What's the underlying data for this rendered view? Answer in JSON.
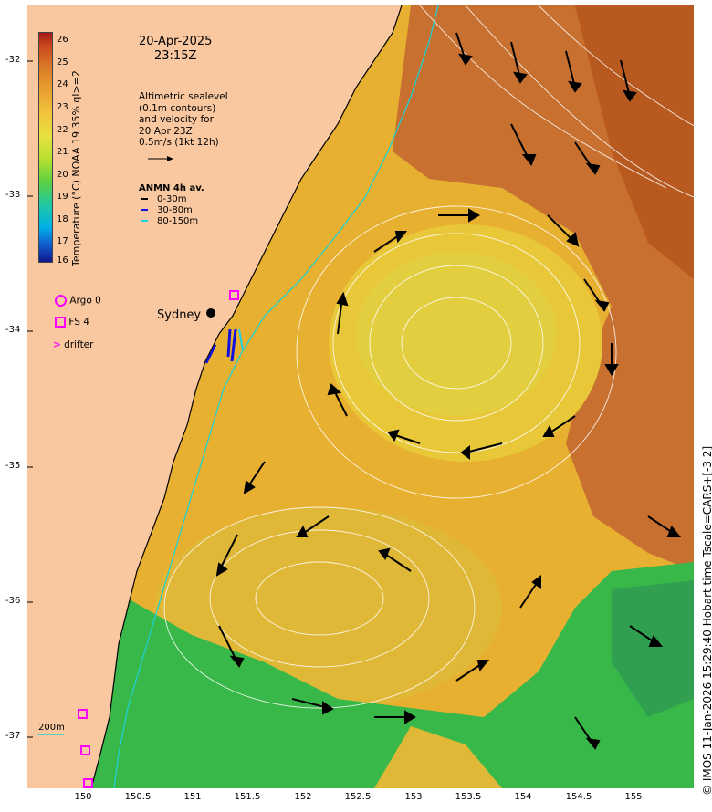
{
  "title": {
    "date": "20-Apr-2025",
    "time": "23:15Z"
  },
  "info": {
    "line1": "Altimetric sealevel",
    "line2": "(0.1m contours)",
    "line3": "and velocity for",
    "line4": "20 Apr 23Z",
    "line5": "0.5m/s (1kt 12h)"
  },
  "anmn": {
    "title": "ANMN 4h av.",
    "rows": [
      {
        "label": "0-30m",
        "color": "#000000"
      },
      {
        "label": "30-80m",
        "color": "#1010e0"
      },
      {
        "label": "80-150m",
        "color": "#20d0e0"
      }
    ]
  },
  "colorbar": {
    "label": "Temperature (°C) NOAA 19 35% ql>=2",
    "ticks": [
      "26",
      "25",
      "24",
      "23",
      "22",
      "21",
      "20",
      "19",
      "18",
      "17",
      "16"
    ]
  },
  "legend": {
    "argo": "Argo 0",
    "fs": "FS 4",
    "drifter": "drifter",
    "marker_color": "#ff00ff"
  },
  "place_label": "Sydney",
  "isobath_label": "200m",
  "lat_ticks": [
    "-32",
    "-33",
    "-34",
    "-35",
    "-36",
    "-37"
  ],
  "lon_ticks": [
    "150",
    "150.5",
    "151",
    "151.5",
    "152",
    "152.5",
    "153",
    "153.5",
    "154",
    "154.5",
    "155"
  ],
  "footer": "© IMOS 11-Jan-2026 15:29:40 Hobart time Tscale=CARS+[-3 2]",
  "colors": {
    "land": "#f9c8a0",
    "warm_eddy": "#e8c830",
    "cool_shelf": "#30b848",
    "warm_offshore": "#c06820",
    "velocity_arrow": "#000000",
    "isobath": "#20d0d0"
  }
}
